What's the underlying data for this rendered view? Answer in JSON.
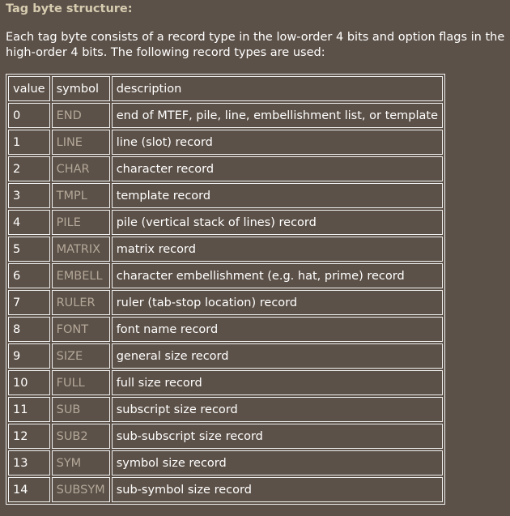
{
  "heading": "Tag byte structure:",
  "intro": "Each tag byte consists of a record type in the low-order 4 bits and option flags in the high-order 4 bits. The following record types are used:",
  "table": {
    "headers": [
      "value",
      "symbol",
      "description"
    ],
    "rows": [
      {
        "value": "0",
        "symbol": "END",
        "description": "end of MTEF, pile, line, embellishment list, or template"
      },
      {
        "value": "1",
        "symbol": "LINE",
        "description": "line (slot) record"
      },
      {
        "value": "2",
        "symbol": "CHAR",
        "description": "character record"
      },
      {
        "value": "3",
        "symbol": "TMPL",
        "description": "template record"
      },
      {
        "value": "4",
        "symbol": "PILE",
        "description": "pile (vertical stack of lines) record"
      },
      {
        "value": "5",
        "symbol": "MATRIX",
        "description": "matrix record"
      },
      {
        "value": "6",
        "symbol": "EMBELL",
        "description": "character embellishment (e.g. hat, prime) record"
      },
      {
        "value": "7",
        "symbol": "RULER",
        "description": "ruler (tab-stop location) record"
      },
      {
        "value": "8",
        "symbol": "FONT",
        "description": "font name record"
      },
      {
        "value": "9",
        "symbol": "SIZE",
        "description": "general size record"
      },
      {
        "value": "10",
        "symbol": "FULL",
        "description": "full size record"
      },
      {
        "value": "11",
        "symbol": "SUB",
        "description": "subscript size record"
      },
      {
        "value": "12",
        "symbol": "SUB2",
        "description": "sub-subscript size record"
      },
      {
        "value": "13",
        "symbol": "SYM",
        "description": "symbol size record"
      },
      {
        "value": "14",
        "symbol": "SUBSYM",
        "description": "sub-symbol size record"
      }
    ]
  }
}
